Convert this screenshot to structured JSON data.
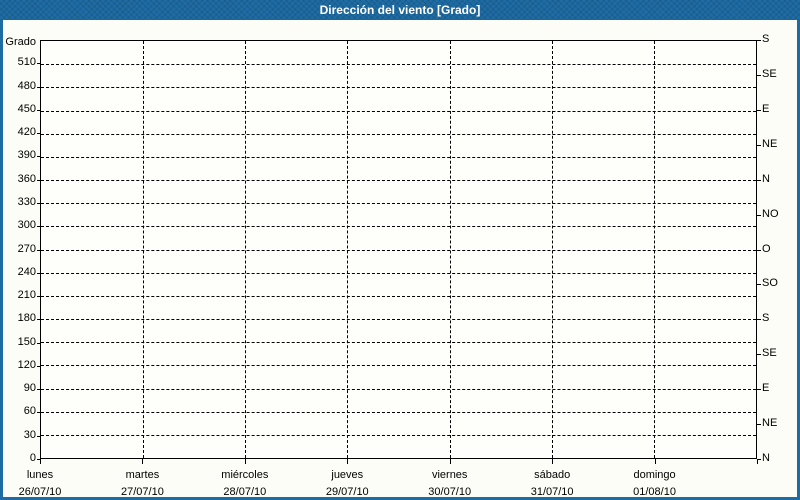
{
  "window": {
    "title": "Dirección del viento [Grado]",
    "title_bar_color": "#1E6CA3",
    "border_color": "#1E6CA3",
    "title_text_color": "#FFFFFF"
  },
  "chart_data": {
    "type": "line",
    "title": "Dirección del viento [Grado]",
    "ylabel": "Grado",
    "xlabel": "",
    "ylim": [
      0,
      540
    ],
    "grid": "dashed-black",
    "legend": "none",
    "series": [],
    "y_axis_left": {
      "label": "Grado",
      "min": 0,
      "max": 540,
      "tick_interval": 30,
      "ticks": [
        510,
        480,
        450,
        420,
        390,
        360,
        330,
        300,
        270,
        240,
        210,
        180,
        150,
        120,
        90,
        60,
        30,
        0
      ]
    },
    "y_axis_right": {
      "tick_interval": 45,
      "ticks": [
        {
          "value": 540,
          "label": "S"
        },
        {
          "value": 495,
          "label": "SE"
        },
        {
          "value": 450,
          "label": "E"
        },
        {
          "value": 405,
          "label": "NE"
        },
        {
          "value": 360,
          "label": "N"
        },
        {
          "value": 315,
          "label": "NO"
        },
        {
          "value": 270,
          "label": "O"
        },
        {
          "value": 225,
          "label": "SO"
        },
        {
          "value": 180,
          "label": "S"
        },
        {
          "value": 135,
          "label": "SE"
        },
        {
          "value": 90,
          "label": "E"
        },
        {
          "value": 45,
          "label": "NE"
        },
        {
          "value": 0,
          "label": "N"
        }
      ]
    },
    "x_axis": {
      "categories": [
        {
          "day": "lunes",
          "date": "26/07/10"
        },
        {
          "day": "martes",
          "date": "27/07/10"
        },
        {
          "day": "miércoles",
          "date": "28/07/10"
        },
        {
          "day": "jueves",
          "date": "29/07/10"
        },
        {
          "day": "viernes",
          "date": "30/07/10"
        },
        {
          "day": "sábado",
          "date": "31/07/10"
        },
        {
          "day": "domingo",
          "date": "01/08/10"
        }
      ],
      "days_shown": 7
    }
  }
}
